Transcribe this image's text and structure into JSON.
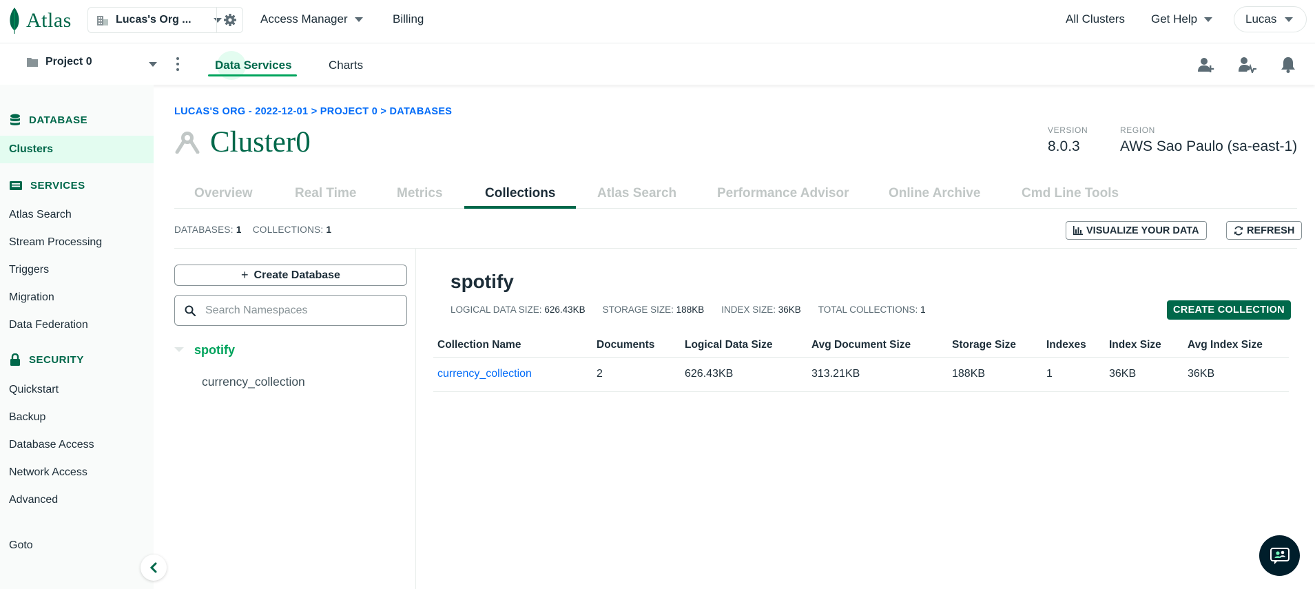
{
  "topbar": {
    "logo_text": "Atlas",
    "org_name": "Lucas's Org ...",
    "nav": [
      "Access Manager",
      "Billing"
    ],
    "all_clusters": "All Clusters",
    "get_help": "Get Help",
    "user": "Lucas"
  },
  "projectbar": {
    "project_name": "Project 0",
    "tabs": [
      "Data Services",
      "Charts"
    ],
    "active_tab": "Data Services"
  },
  "sidebar": {
    "database_header": "DATABASE",
    "database_items": [
      "Clusters"
    ],
    "services_header": "SERVICES",
    "services_items": [
      "Atlas Search",
      "Stream Processing",
      "Triggers",
      "Migration",
      "Data Federation"
    ],
    "security_header": "SECURITY",
    "security_items": [
      "Quickstart",
      "Backup",
      "Database Access",
      "Network Access",
      "Advanced"
    ],
    "goto": "Goto",
    "active_item": "Clusters"
  },
  "main": {
    "breadcrumb": "LUCAS'S ORG - 2022-12-01 > PROJECT 0 > DATABASES",
    "cluster_name": "Cluster0",
    "version_label": "VERSION",
    "version_value": "8.0.3",
    "region_label": "REGION",
    "region_value": "AWS Sao Paulo (sa-east-1)",
    "tabs": [
      "Overview",
      "Real Time",
      "Metrics",
      "Collections",
      "Atlas Search",
      "Performance Advisor",
      "Online Archive",
      "Cmd Line Tools"
    ],
    "active_tab": "Collections",
    "databases_label": "DATABASES:",
    "databases_count": "1",
    "collections_label": "COLLECTIONS:",
    "collections_count": "1",
    "visualize_button": "VISUALIZE YOUR DATA",
    "refresh_button": "REFRESH"
  },
  "namespace_panel": {
    "create_database": "Create Database",
    "search_placeholder": "Search Namespaces",
    "database": "spotify",
    "collection": "currency_collection"
  },
  "detail": {
    "db_name": "spotify",
    "stats": [
      {
        "label": "LOGICAL DATA SIZE:",
        "value": "626.43KB"
      },
      {
        "label": "STORAGE SIZE:",
        "value": "188KB"
      },
      {
        "label": "INDEX SIZE:",
        "value": "36KB"
      },
      {
        "label": "TOTAL COLLECTIONS:",
        "value": "1"
      }
    ],
    "create_collection": "CREATE COLLECTION",
    "table": {
      "headers": [
        "Collection Name",
        "Documents",
        "Logical Data Size",
        "Avg Document Size",
        "Storage Size",
        "Indexes",
        "Index Size",
        "Avg Index Size"
      ],
      "rows": [
        [
          "currency_collection",
          "2",
          "626.43KB",
          "313.21KB",
          "188KB",
          "1",
          "36KB",
          "36KB"
        ]
      ]
    }
  },
  "colors": {
    "brand_green": "#00684a",
    "accent_green": "#00a35c",
    "link_blue": "#016bf8",
    "dark_navy": "#001e2b"
  },
  "icons": [
    "leaf-icon",
    "building-icon",
    "gear-icon",
    "folder-icon",
    "kebab-icon",
    "add-user-icon",
    "user-activity-icon",
    "bell-icon",
    "database-icon",
    "services-icon",
    "lock-icon",
    "chevron-left-icon",
    "cluster-icon",
    "bar-chart-icon",
    "refresh-icon",
    "search-icon",
    "chat-icon"
  ]
}
